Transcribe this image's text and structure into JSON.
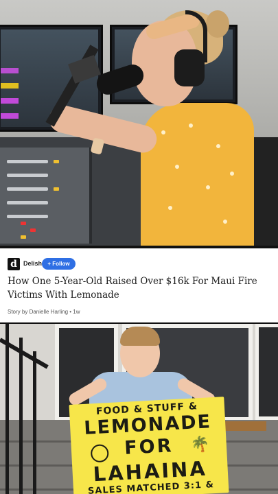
{
  "source": {
    "name": "Delish",
    "logo_letter": "d",
    "follow_label": "Follow",
    "follow_icon": "plus-icon"
  },
  "article": {
    "headline": "How One 5-Year-Old Raised Over $16k For Maui Fire Victims With Lemonade",
    "byline": "Story by Danielle Harling • 1w"
  },
  "sign": {
    "line1": "FOOD & STUFF &",
    "line2": "LEMONADE",
    "line3": "FOR",
    "line4": "LAHAINA",
    "line5": "SALES MATCHED 3:1 &"
  },
  "colors": {
    "follow_button": "#2f6fe4",
    "sign_yellow": "#f7e64a",
    "dress_yellow": "#f2b53c"
  }
}
